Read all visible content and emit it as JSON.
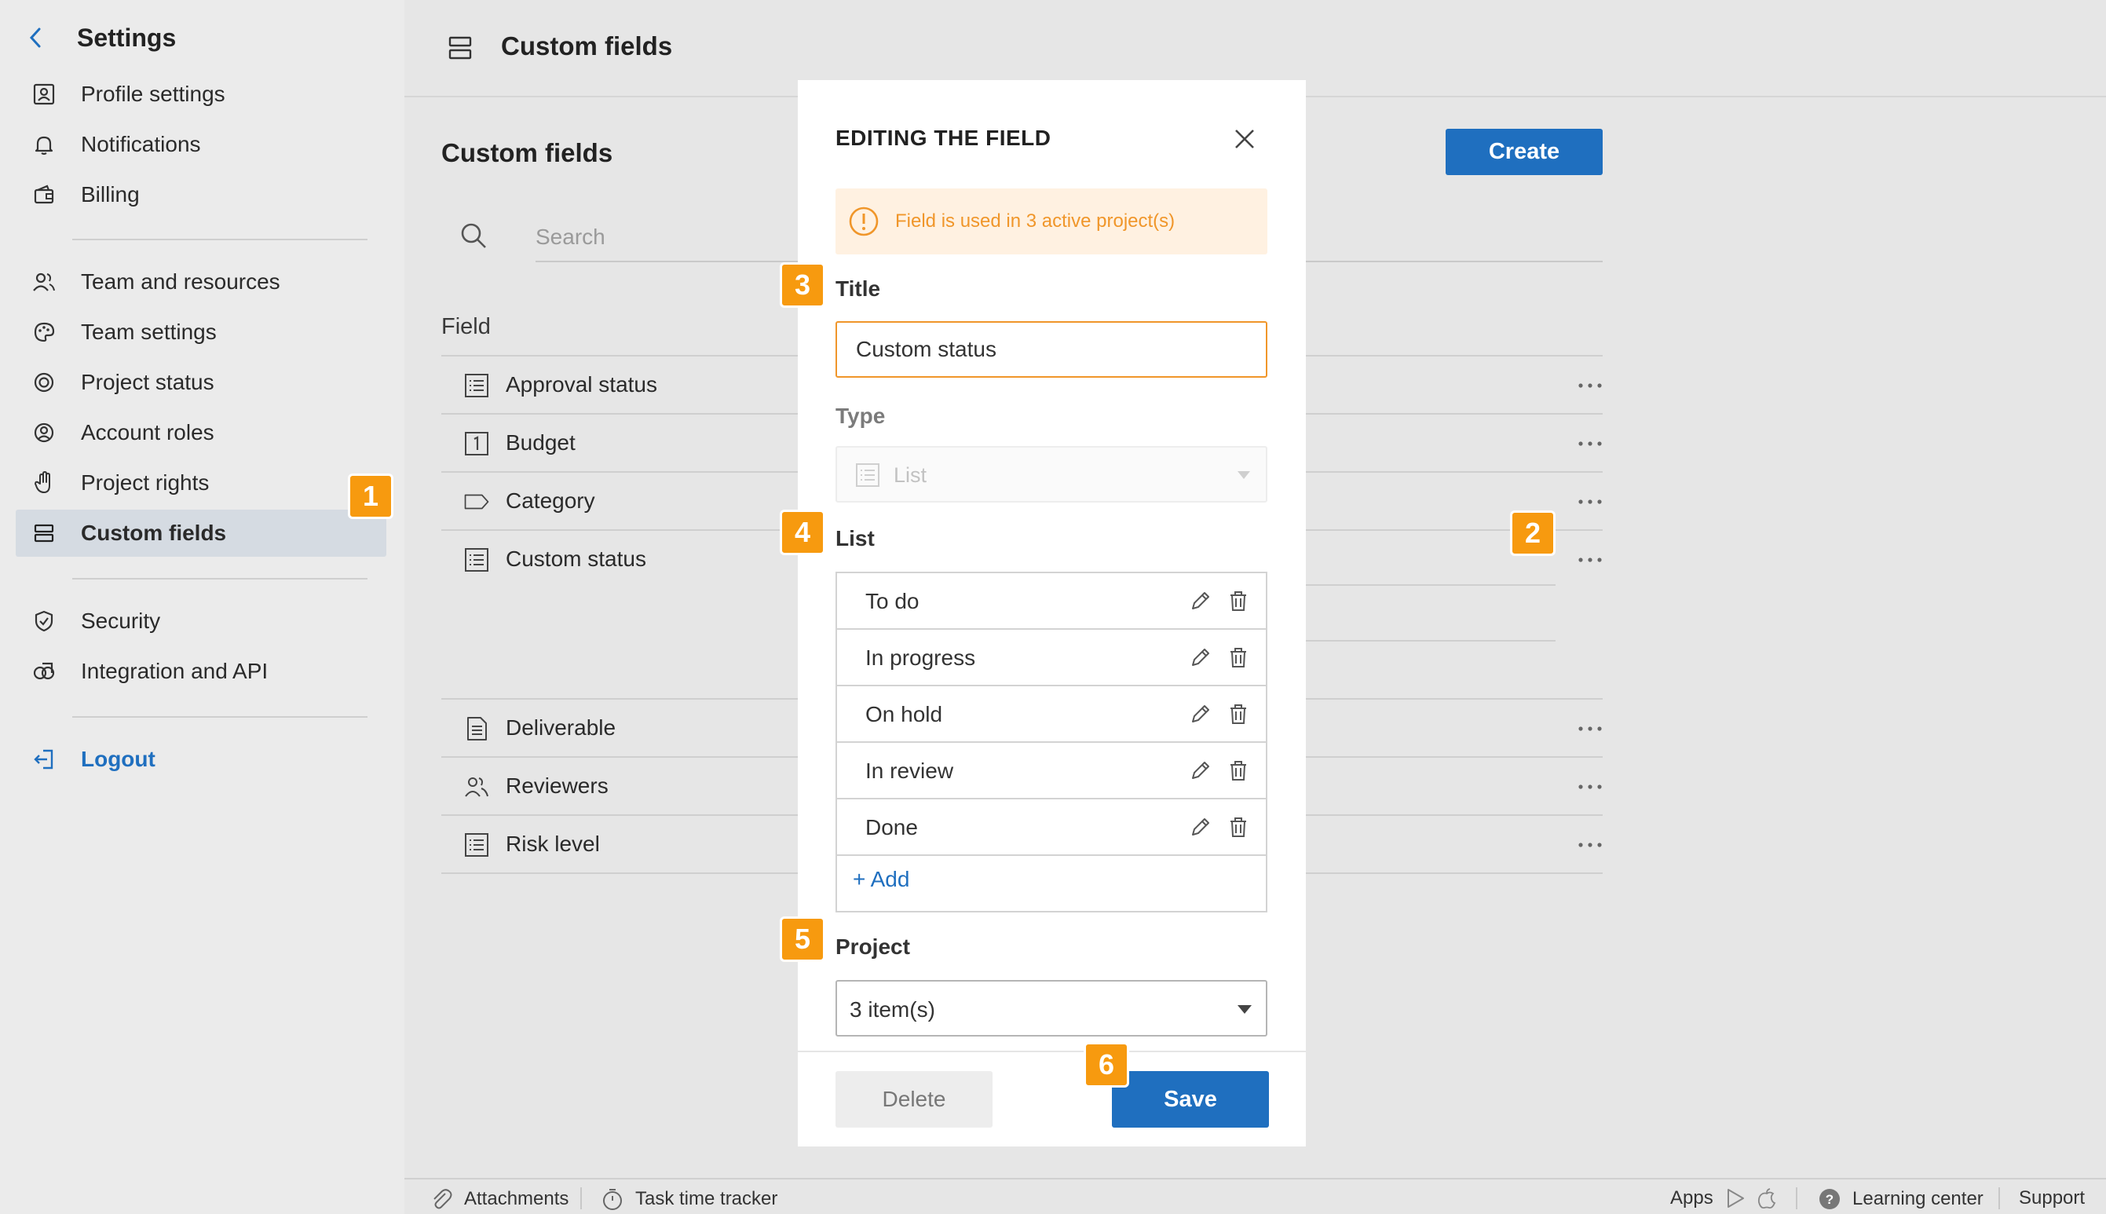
{
  "sidebar": {
    "title": "Settings",
    "items": [
      {
        "label": "Profile settings"
      },
      {
        "label": "Notifications"
      },
      {
        "label": "Billing"
      },
      {
        "label": "Team and resources"
      },
      {
        "label": "Team settings"
      },
      {
        "label": "Project status"
      },
      {
        "label": "Account roles"
      },
      {
        "label": "Project rights"
      },
      {
        "label": "Custom fields"
      },
      {
        "label": "Security"
      },
      {
        "label": "Integration and API"
      }
    ],
    "logout": "Logout"
  },
  "header": {
    "title": "Custom fields"
  },
  "content": {
    "title": "Custom fields",
    "create_label": "Create",
    "search_placeholder": "Search",
    "column_field": "Field",
    "rows": [
      {
        "label": "Approval status",
        "icon": "list-icon"
      },
      {
        "label": "Budget",
        "icon": "number-icon"
      },
      {
        "label": "Category",
        "icon": "tag-icon"
      },
      {
        "label": "Custom status",
        "icon": "list-icon"
      },
      {
        "label": "Deliverable",
        "icon": "document-icon"
      },
      {
        "label": "Reviewers",
        "icon": "users-icon"
      },
      {
        "label": "Risk level",
        "icon": "list-icon"
      }
    ]
  },
  "badges": [
    "1",
    "2",
    "3",
    "4",
    "5",
    "6"
  ],
  "modal": {
    "title": "EDITING THE FIELD",
    "warning": "Field is used in 3 active project(s)",
    "title_label": "Title",
    "title_value": "Custom status",
    "type_label": "Type",
    "type_value": "List",
    "list_label": "List",
    "list_items": [
      "To do",
      "In progress",
      "On hold",
      "In review",
      "Done"
    ],
    "add_label": "+ Add",
    "project_label": "Project",
    "project_value": "3 item(s)",
    "delete_label": "Delete",
    "save_label": "Save"
  },
  "footer": {
    "attachments": "Attachments",
    "tracker": "Task time tracker",
    "apps": "Apps",
    "learning": "Learning center",
    "support": "Support"
  },
  "colors": {
    "accent": "#1f6fbf",
    "badge": "#f79a0f",
    "warning_text": "#f0962a",
    "warning_bg": "#fff1e1"
  }
}
